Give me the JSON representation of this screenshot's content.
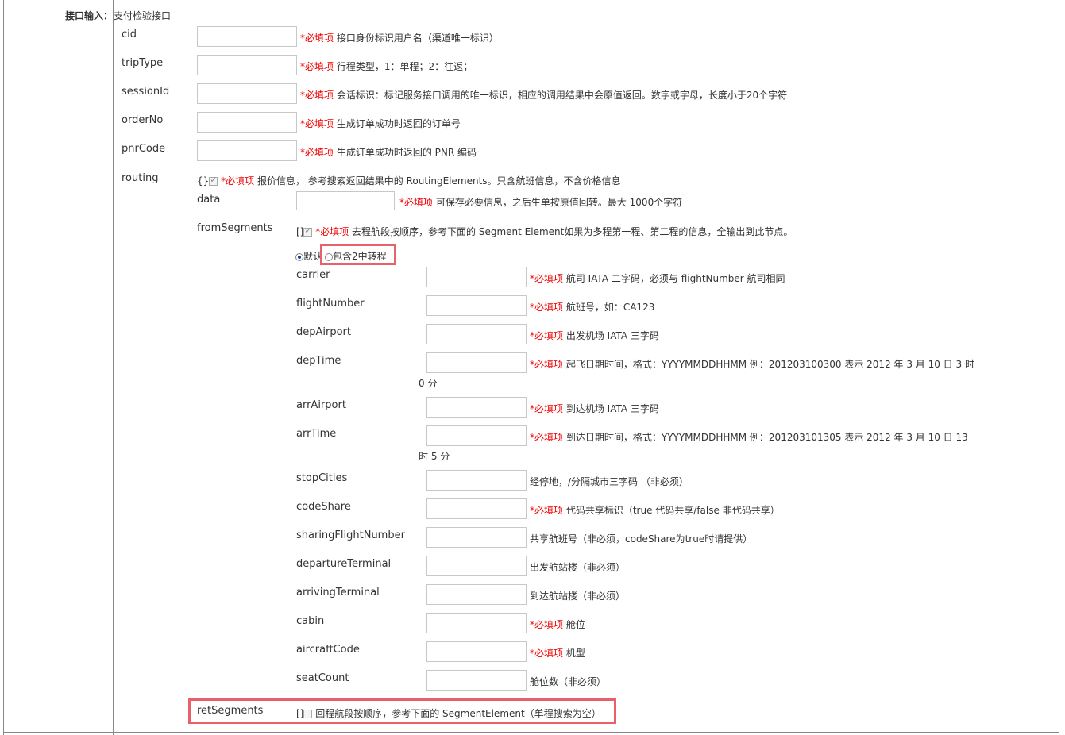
{
  "header": {
    "section_label": "接口输入：",
    "section_value": "支付检验接口"
  },
  "required_tag": "*必填项",
  "top_fields": [
    {
      "name": "cid",
      "required": true,
      "desc": "接口身份标识用户名（渠道唯一标识）"
    },
    {
      "name": "tripType",
      "required": true,
      "desc": "行程类型，1：单程；2：往返；"
    },
    {
      "name": "sessionId",
      "required": true,
      "desc": "会话标识：标记服务接口调用的唯一标识，相应的调用结果中会原值返回。数字或字母，长度小于20个字符"
    },
    {
      "name": "orderNo",
      "required": true,
      "desc": "生成订单成功时返回的订单号"
    },
    {
      "name": "pnrCode",
      "required": true,
      "desc": "生成订单成功时返回的 PNR 编码"
    }
  ],
  "routing": {
    "name": "routing",
    "type_marker": "{}",
    "desc": "报价信息， 参考搜索返回结果中的 RoutingElements。只含航班信息，不含价格信息",
    "data_field": {
      "name": "data",
      "desc": "可保存必要信息，之后生单按原值回转。最大 1000个字符"
    },
    "from_segments": {
      "name": "fromSegments",
      "type_marker": "[]",
      "desc": "去程航段按顺序，参考下面的 Segment Element如果为多程第一程、第二程的信息，全输出到此节点。",
      "radio_default": "默认",
      "radio_transfer": "包含2中转程"
    },
    "segment_fields": [
      {
        "name": "carrier",
        "required": true,
        "desc": "航司 IATA 二字码，必须与 flightNumber 航司相同"
      },
      {
        "name": "flightNumber",
        "required": true,
        "desc": "航班号，如：CA123"
      },
      {
        "name": "depAirport",
        "required": true,
        "desc": "出发机场 IATA 三字码"
      },
      {
        "name": "depTime",
        "required": true,
        "desc": "起飞日期时间，格式：YYYYMMDDHHMM 例：201203100300 表示 2012 年 3 月 10 日 3 时",
        "desc_wrap": "0 分"
      },
      {
        "name": "arrAirport",
        "required": true,
        "desc": "到达机场 IATA 三字码"
      },
      {
        "name": "arrTime",
        "required": true,
        "desc": "到达日期时间，格式：YYYYMMDDHHMM 例：201203101305 表示 2012 年 3 月 10 日 13",
        "desc_wrap": "时 5 分"
      },
      {
        "name": "stopCities",
        "required": false,
        "desc": "经停地，/分隔城市三字码 （非必须）"
      },
      {
        "name": "codeShare",
        "required": true,
        "desc": "代码共享标识（true 代码共享/false 非代码共享）"
      },
      {
        "name": "sharingFlightNumber",
        "required": false,
        "desc": "共享航班号（非必须，codeShare为true时请提供）"
      },
      {
        "name": "departureTerminal",
        "required": false,
        "desc": "出发航站楼（非必须）"
      },
      {
        "name": "arrivingTerminal",
        "required": false,
        "desc": "到达航站楼（非必须）"
      },
      {
        "name": "cabin",
        "required": true,
        "desc": "舱位"
      },
      {
        "name": "aircraftCode",
        "required": true,
        "desc": "机型"
      },
      {
        "name": "seatCount",
        "required": false,
        "desc": "舱位数（非必须）"
      }
    ],
    "ret_segments": {
      "name": "retSegments",
      "type_marker": "[]",
      "desc": "回程航段按顺序，参考下面的 SegmentElement（单程搜索为空）"
    }
  },
  "colors": {
    "required": "#ee0000",
    "highlight": "#e8606a",
    "border": "#888888"
  }
}
